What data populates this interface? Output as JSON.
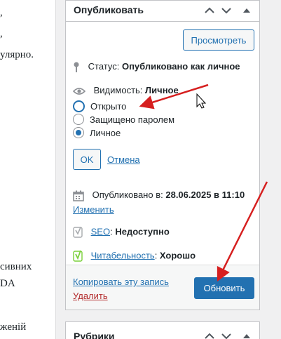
{
  "editor": {
    "lines": [
      ",",
      ",",
      "улярно.",
      "сивних",
      "DA",
      "жeній"
    ]
  },
  "publish": {
    "title": "Опубликовать",
    "preview_label": "Просмотреть",
    "status_label": "Статус:",
    "status_value": "Опубликовано как личное",
    "visibility_label": "Видимость:",
    "visibility_value": "Личное",
    "visibility_options": [
      {
        "label": "Открыто",
        "checked": false,
        "focused": true
      },
      {
        "label": "Защищено паролем",
        "checked": false,
        "focused": false
      },
      {
        "label": "Личное",
        "checked": true,
        "focused": false
      }
    ],
    "ok_label": "OK",
    "cancel_label": "Отмена",
    "published_label": "Опубликовано в:",
    "published_value": "28.06.2025 в 11:10",
    "edit_label": "Изменить",
    "seo_link": "SEO",
    "seo_value": "Недоступно",
    "readability_link": "Читабельность",
    "readability_value": "Хорошо",
    "copy_label": "Копировать эту запись",
    "delete_label": "Удалить",
    "update_label": "Обновить"
  },
  "categories": {
    "title": "Рубрики"
  },
  "colors": {
    "accent": "#2271b1",
    "delete": "#b32d2e",
    "annotation": "#d61f1f",
    "seo_icon": "#a7aaad",
    "readability_icon": "#7ad03a"
  }
}
